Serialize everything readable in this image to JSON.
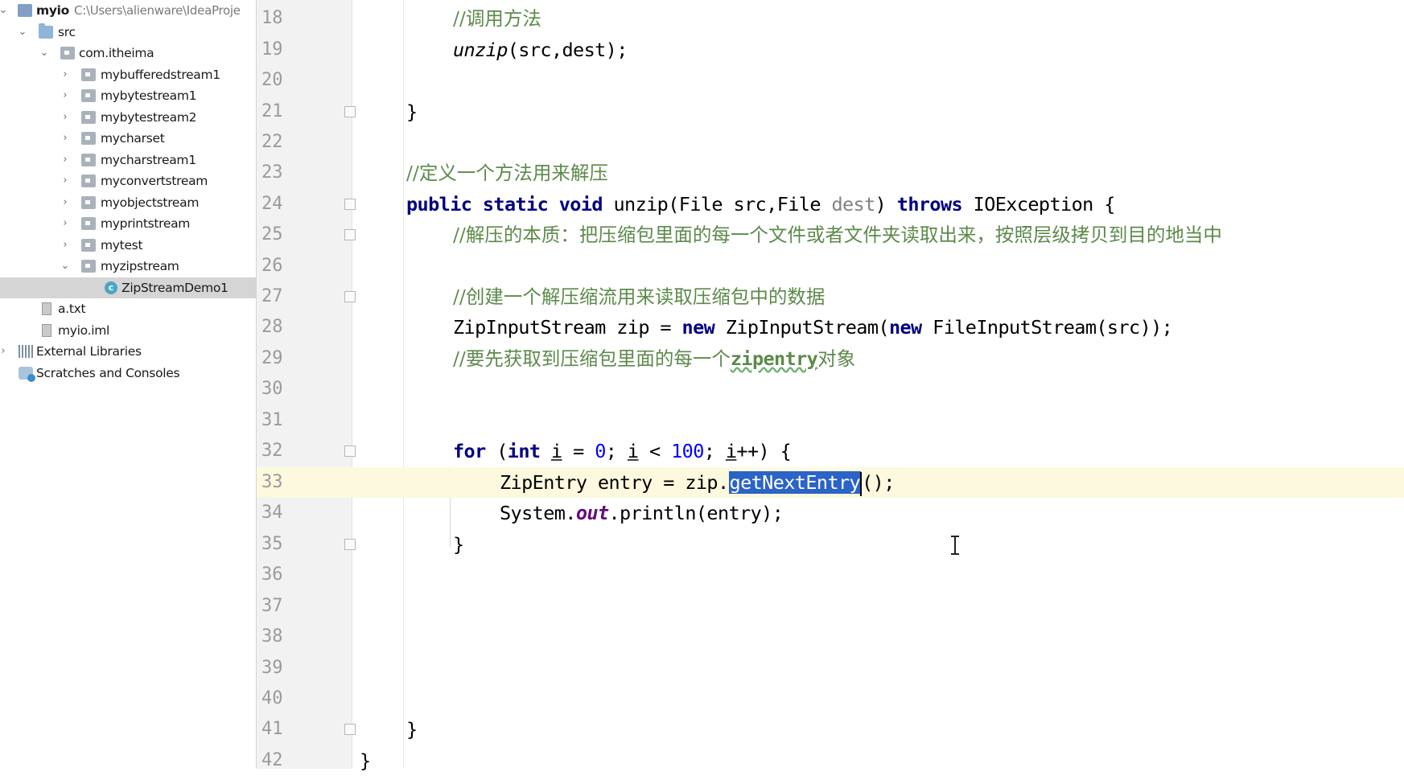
{
  "project_tree": {
    "items": [
      {
        "label": "myio",
        "path": "C:\\Users\\alienware\\IdeaProje",
        "icon": "project-icon",
        "arrow": "down"
      },
      {
        "label": "src",
        "icon": "folder-icon",
        "arrow": "down"
      },
      {
        "label": "com.itheima",
        "icon": "package-icon",
        "arrow": "down"
      },
      {
        "label": "mybufferedstream1",
        "icon": "package-icon",
        "arrow": "right"
      },
      {
        "label": "mybytestream1",
        "icon": "package-icon",
        "arrow": "right"
      },
      {
        "label": "mybytestream2",
        "icon": "package-icon",
        "arrow": "right"
      },
      {
        "label": "mycharset",
        "icon": "package-icon",
        "arrow": "right"
      },
      {
        "label": "mycharstream1",
        "icon": "package-icon",
        "arrow": "right"
      },
      {
        "label": "myconvertstream",
        "icon": "package-icon",
        "arrow": "right"
      },
      {
        "label": "myobjectstream",
        "icon": "package-icon",
        "arrow": "right"
      },
      {
        "label": "myprintstream",
        "icon": "package-icon",
        "arrow": "right"
      },
      {
        "label": "mytest",
        "icon": "package-icon",
        "arrow": "right"
      },
      {
        "label": "myzipstream",
        "icon": "package-icon",
        "arrow": "down"
      },
      {
        "label": "ZipStreamDemo1",
        "icon": "java-class-icon",
        "arrow": "",
        "selected": true
      },
      {
        "label": "a.txt",
        "icon": "text-file-icon",
        "arrow": ""
      },
      {
        "label": "myio.iml",
        "icon": "iml-file-icon",
        "arrow": ""
      },
      {
        "label": "External Libraries",
        "icon": "library-icon",
        "arrow": "right"
      },
      {
        "label": "Scratches and Consoles",
        "icon": "scratches-icon",
        "arrow": ""
      }
    ]
  },
  "editor": {
    "current_line": 33,
    "selected_text": "getNextEntry",
    "line_numbers": [
      "18",
      "19",
      "20",
      "21",
      "22",
      "23",
      "24",
      "25",
      "26",
      "27",
      "28",
      "29",
      "30",
      "31",
      "32",
      "33",
      "34",
      "35",
      "36",
      "37",
      "38",
      "39",
      "40",
      "41",
      "42"
    ],
    "code": {
      "l18_comment": "//调用方法",
      "l19_method": "unzip",
      "l19_args": "(src,dest);",
      "l21": "}",
      "l23_comment": "//定义一个方法用来解压",
      "l24_public": "public",
      "l24_static": "static",
      "l24_void": "void",
      "l24_sig": "unzip(File src,File ",
      "l24_dest": "dest",
      "l24_close": ")",
      "l24_throws": "throws",
      "l24_exc": "IOException {",
      "l25_comment": "//解压的本质：把压缩包里面的每一个文件或者文件夹读取出来，按照层级拷贝到目的地当中",
      "l27_comment": "//创建一个解压缩流用来读取压缩包中的数据",
      "l28_a": "ZipInputStream zip = ",
      "l28_new1": "new",
      "l28_b": " ZipInputStream(",
      "l28_new2": "new",
      "l28_c": " FileInputStream(src));",
      "l29_comment_a": "//要先获取到压缩包里面的每一个",
      "l29_comment_b": "zipentry",
      "l29_comment_c": "对象",
      "l32_for": "for",
      "l32_paren": " (",
      "l32_int": "int",
      "l32_i1": "i",
      "l32_eq": " = ",
      "l32_zero": "0",
      "l32_semi1": "; ",
      "l32_i2": "i",
      "l32_lt": " < ",
      "l32_hundred": "100",
      "l32_semi2": "; ",
      "l32_i3": "i",
      "l32_end": "++) {",
      "l33_a": "ZipEntry entry = zip.",
      "l33_sel": "getNextEntry",
      "l33_b": "();",
      "l34_a": "System.",
      "l34_out": "out",
      "l34_b": ".println(entry);",
      "l35": "}",
      "l41": "}",
      "l42": "}"
    }
  }
}
